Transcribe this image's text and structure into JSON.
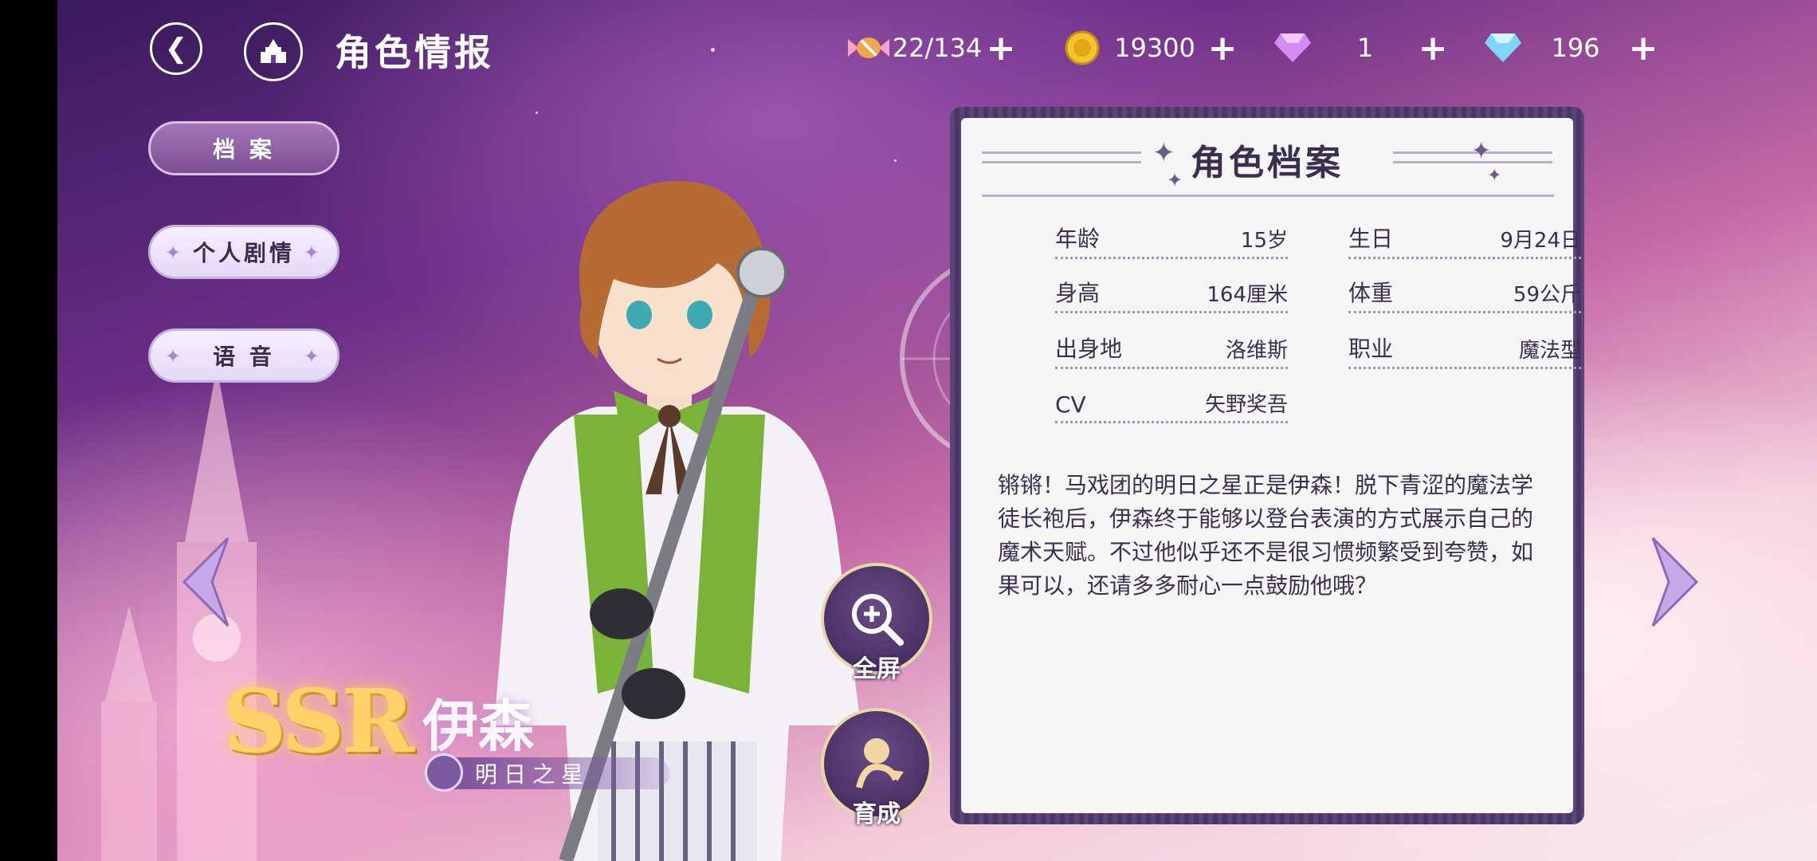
{
  "header": {
    "title": "角色情报",
    "back_icon": "back-arrow-icon",
    "home_icon": "castle-icon"
  },
  "currencies": [
    {
      "icon": "candy-icon",
      "value": "22/134",
      "color": "#f0a64a"
    },
    {
      "icon": "gold-coin-icon",
      "value": "19300",
      "color": "#f5c531"
    },
    {
      "icon": "pink-diamond-icon",
      "value": "1",
      "color": "#d58cf2"
    },
    {
      "icon": "blue-diamond-icon",
      "value": "196",
      "color": "#7fd6f5"
    }
  ],
  "side_tabs": [
    {
      "label": "档 案",
      "active": true
    },
    {
      "label": "个人剧情",
      "active": false
    },
    {
      "label": "语 音",
      "active": false
    }
  ],
  "character": {
    "rarity": "SSR",
    "name": "伊森",
    "title": "明日之星"
  },
  "actions": {
    "fullscreen_label": "全屏",
    "train_label": "育成"
  },
  "profile": {
    "panel_title": "角色档案",
    "fields": [
      {
        "label": "年龄",
        "value": "15岁"
      },
      {
        "label": "生日",
        "value": "9月24日"
      },
      {
        "label": "身高",
        "value": "164厘米"
      },
      {
        "label": "体重",
        "value": "59公斤"
      },
      {
        "label": "出身地",
        "value": "洛维斯"
      },
      {
        "label": "职业",
        "value": "魔法型"
      },
      {
        "label": "CV",
        "value": "矢野奖吾"
      }
    ],
    "description": "锵锵！马戏团的明日之星正是伊森！脱下青涩的魔法学徒长袍后，伊森终于能够以登台表演的方式展示自己的魔术天赋。不过他似乎还不是很习惯频繁受到夸赞，如果可以，还请多多耐心一点鼓励他哦？"
  },
  "colors": {
    "panel_frame": "#5a4478",
    "accent_purple": "#7b4f94",
    "ssr_gold": "#ffd36a"
  }
}
